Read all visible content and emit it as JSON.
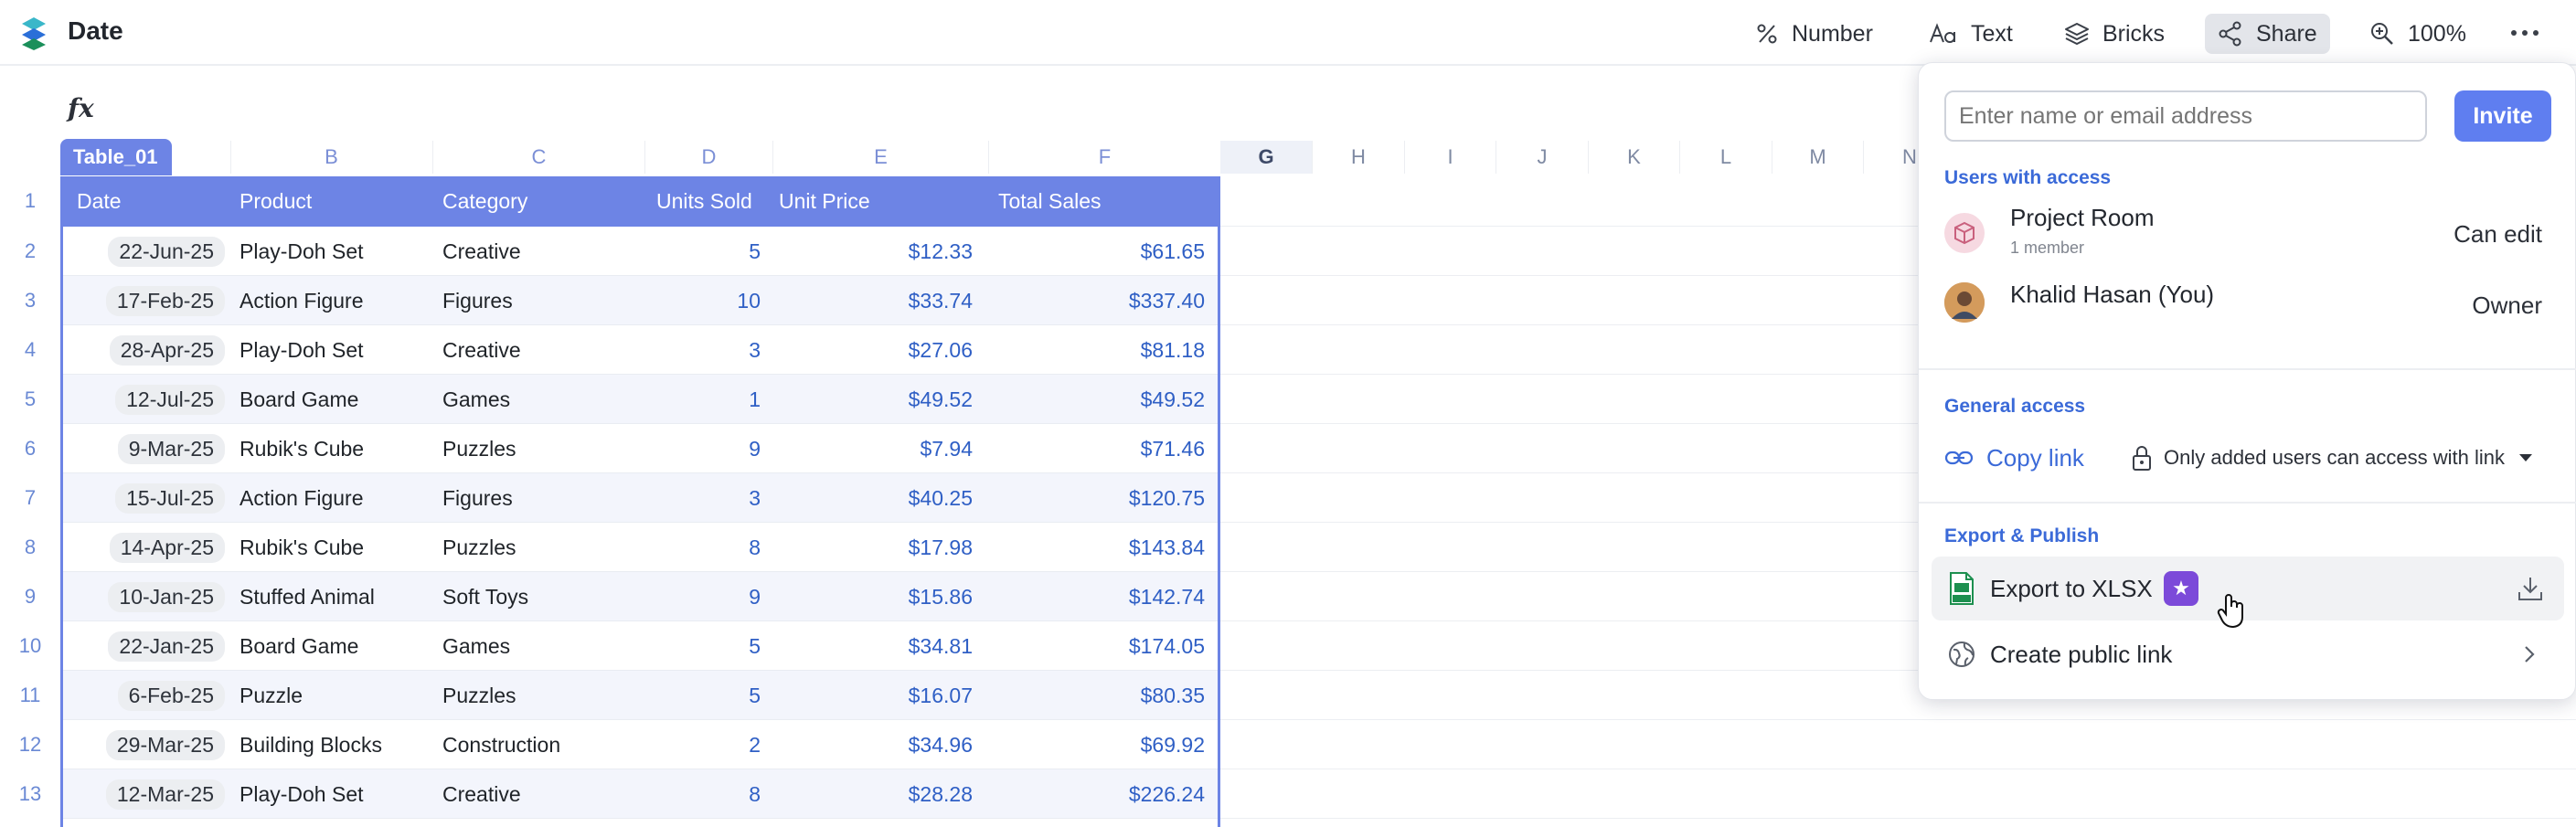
{
  "app": {
    "title": "Date"
  },
  "toolbar": {
    "number_label": "Number",
    "text_label": "Text",
    "bricks_label": "Bricks",
    "share_label": "Share",
    "zoom_label": "100%"
  },
  "formula_bar": {
    "fx_label": "fx"
  },
  "grid": {
    "table_name": "Table_01",
    "column_letters": [
      "B",
      "C",
      "D",
      "E",
      "F",
      "G",
      "H",
      "I",
      "J",
      "K",
      "L",
      "M",
      "N"
    ],
    "row_numbers": [
      "1",
      "2",
      "3",
      "4",
      "5",
      "6",
      "7",
      "8",
      "9",
      "10",
      "11",
      "12",
      "13"
    ],
    "headers": {
      "date": "Date",
      "product": "Product",
      "category": "Category",
      "units": "Units Sold",
      "price": "Unit Price",
      "total": "Total Sales"
    },
    "rows": [
      {
        "date": "22-Jun-25",
        "product": "Play-Doh Set",
        "category": "Creative",
        "units": "5",
        "price": "$12.33",
        "total": "$61.65"
      },
      {
        "date": "17-Feb-25",
        "product": "Action Figure",
        "category": "Figures",
        "units": "10",
        "price": "$33.74",
        "total": "$337.40"
      },
      {
        "date": "28-Apr-25",
        "product": "Play-Doh Set",
        "category": "Creative",
        "units": "3",
        "price": "$27.06",
        "total": "$81.18"
      },
      {
        "date": "12-Jul-25",
        "product": "Board Game",
        "category": "Games",
        "units": "1",
        "price": "$49.52",
        "total": "$49.52"
      },
      {
        "date": "9-Mar-25",
        "product": "Rubik's Cube",
        "category": "Puzzles",
        "units": "9",
        "price": "$7.94",
        "total": "$71.46"
      },
      {
        "date": "15-Jul-25",
        "product": "Action Figure",
        "category": "Figures",
        "units": "3",
        "price": "$40.25",
        "total": "$120.75"
      },
      {
        "date": "14-Apr-25",
        "product": "Rubik's Cube",
        "category": "Puzzles",
        "units": "8",
        "price": "$17.98",
        "total": "$143.84"
      },
      {
        "date": "10-Jan-25",
        "product": "Stuffed Animal",
        "category": "Soft Toys",
        "units": "9",
        "price": "$15.86",
        "total": "$142.74"
      },
      {
        "date": "22-Jan-25",
        "product": "Board Game",
        "category": "Games",
        "units": "5",
        "price": "$34.81",
        "total": "$174.05"
      },
      {
        "date": "6-Feb-25",
        "product": "Puzzle",
        "category": "Puzzles",
        "units": "5",
        "price": "$16.07",
        "total": "$80.35"
      },
      {
        "date": "29-Mar-25",
        "product": "Building Blocks",
        "category": "Construction",
        "units": "2",
        "price": "$34.96",
        "total": "$69.92"
      },
      {
        "date": "12-Mar-25",
        "product": "Play-Doh Set",
        "category": "Creative",
        "units": "8",
        "price": "$28.28",
        "total": "$226.24"
      }
    ]
  },
  "share": {
    "input_placeholder": "Enter name or email address",
    "invite_label": "Invite",
    "users_title": "Users with access",
    "users": [
      {
        "name": "Project Room",
        "sub": "1 member",
        "role": "Can edit"
      },
      {
        "name": "Khalid Hasan (You)",
        "sub": "",
        "role": "Owner"
      }
    ],
    "general_title": "General access",
    "copy_link_label": "Copy link",
    "access_option": "Only added users can access with link",
    "export_title": "Export & Publish",
    "export_xlsx_label": "Export to XLSX",
    "public_link_label": "Create public link"
  },
  "colors": {
    "accent": "#5f7ef0",
    "table_header": "#6d84e5",
    "link_blue": "#3b6ad8",
    "pro_badge": "#7c4ad9"
  }
}
